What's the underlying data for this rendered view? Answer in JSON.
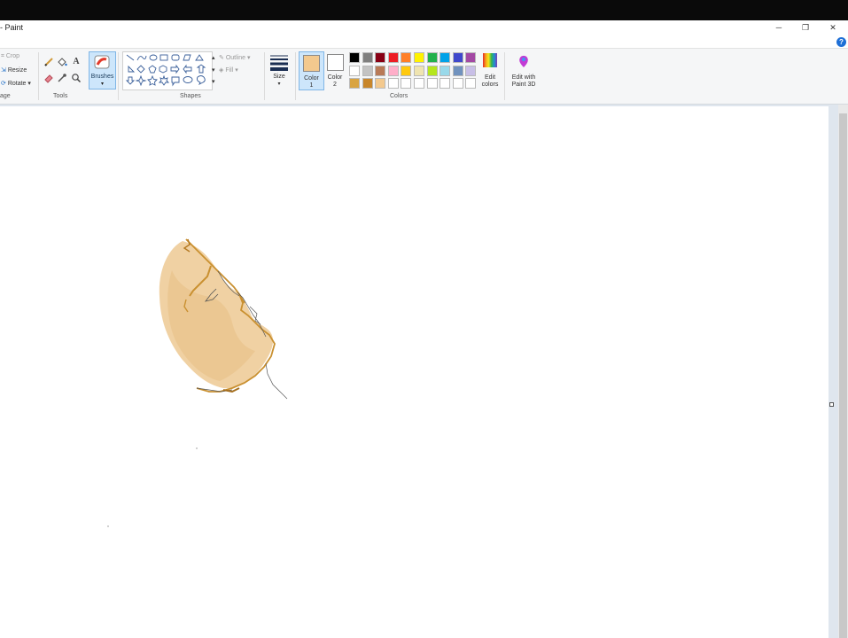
{
  "window": {
    "title": "- Paint",
    "minimize_glyph": "─",
    "restore_glyph": "❐",
    "close_glyph": "✕"
  },
  "help": {
    "label": "?"
  },
  "ribbon": {
    "image": {
      "crop": "Crop",
      "resize": "Resize",
      "rotate": "Rotate",
      "group_label": "age"
    },
    "tools": {
      "group_label": "Tools",
      "pencil_icon": "pencil-icon",
      "fill_icon": "fill-bucket-icon",
      "text_icon": "text-icon",
      "text_glyph": "A",
      "eraser_icon": "eraser-icon",
      "picker_icon": "color-picker-icon",
      "magnifier_icon": "magnifier-icon"
    },
    "brushes": {
      "label": "Brushes",
      "dropdown": "▾"
    },
    "shapes": {
      "group_label": "Shapes",
      "outline": "Outline",
      "fill": "Fill"
    },
    "size": {
      "label": "Size",
      "dropdown": "▾"
    },
    "colors": {
      "group_label": "Colors",
      "color1_label_line1": "Color",
      "color1_label_line2": "1",
      "color2_label_line1": "Color",
      "color2_label_line2": "2",
      "color1_value": "#f3c98e",
      "color2_value": "#ffffff",
      "edit_colors_line1": "Edit",
      "edit_colors_line2": "colors",
      "palette_row1": [
        "#000000",
        "#7f7f7f",
        "#880015",
        "#ed1c24",
        "#ff7f27",
        "#fff200",
        "#22b14c",
        "#00a2e8",
        "#3f48cc",
        "#a349a4"
      ],
      "palette_row2": [
        "#ffffff",
        "#c3c3c3",
        "#b97a57",
        "#ffaec9",
        "#ffc90e",
        "#efe4b0",
        "#b5e61d",
        "#99d9ea",
        "#7092be",
        "#c8bfe7"
      ],
      "palette_row3": [
        "#d9a441",
        "#c8862a",
        "#f3c98e",
        "#ffffff",
        "#ffffff",
        "#ffffff",
        "#ffffff",
        "#ffffff",
        "#ffffff",
        "#ffffff"
      ]
    },
    "paint3d": {
      "line1": "Edit with",
      "line2": "Paint 3D"
    }
  },
  "canvas": {
    "background": "#ffffff",
    "drawing": "skin-tone-sketch"
  }
}
